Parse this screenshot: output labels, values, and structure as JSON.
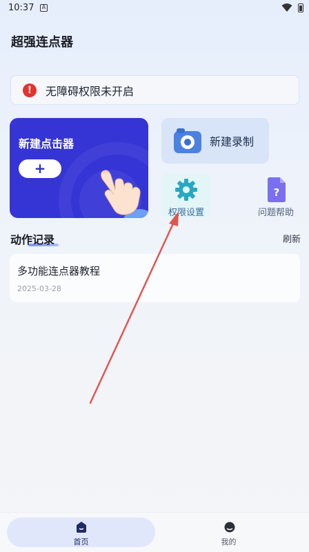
{
  "status_bar": {
    "time": "10:37",
    "notif_glyph": "A"
  },
  "app": {
    "title": "超强连点器"
  },
  "alert": {
    "icon": "!",
    "text": "无障碍权限未开启",
    "icon_color": "#e5322d"
  },
  "cards": {
    "new_clicker": {
      "title": "新建点击器",
      "add_label": "+",
      "bg_color": "#3535d6"
    },
    "new_recording": {
      "label": "新建录制"
    },
    "permissions": {
      "label": "权限设置"
    },
    "help": {
      "label": "问题帮助"
    }
  },
  "records": {
    "title": "动作记录",
    "refresh_label": "刷新",
    "items": [
      {
        "title": "多功能连点器教程",
        "date": "2025-03-28"
      }
    ]
  },
  "bottom_nav": {
    "items": [
      {
        "label": "首页",
        "icon": "home-icon",
        "active": true
      },
      {
        "label": "我的",
        "icon": "profile-icon",
        "active": false
      }
    ]
  },
  "annotation": {
    "arrow_color": "#e2554f"
  }
}
